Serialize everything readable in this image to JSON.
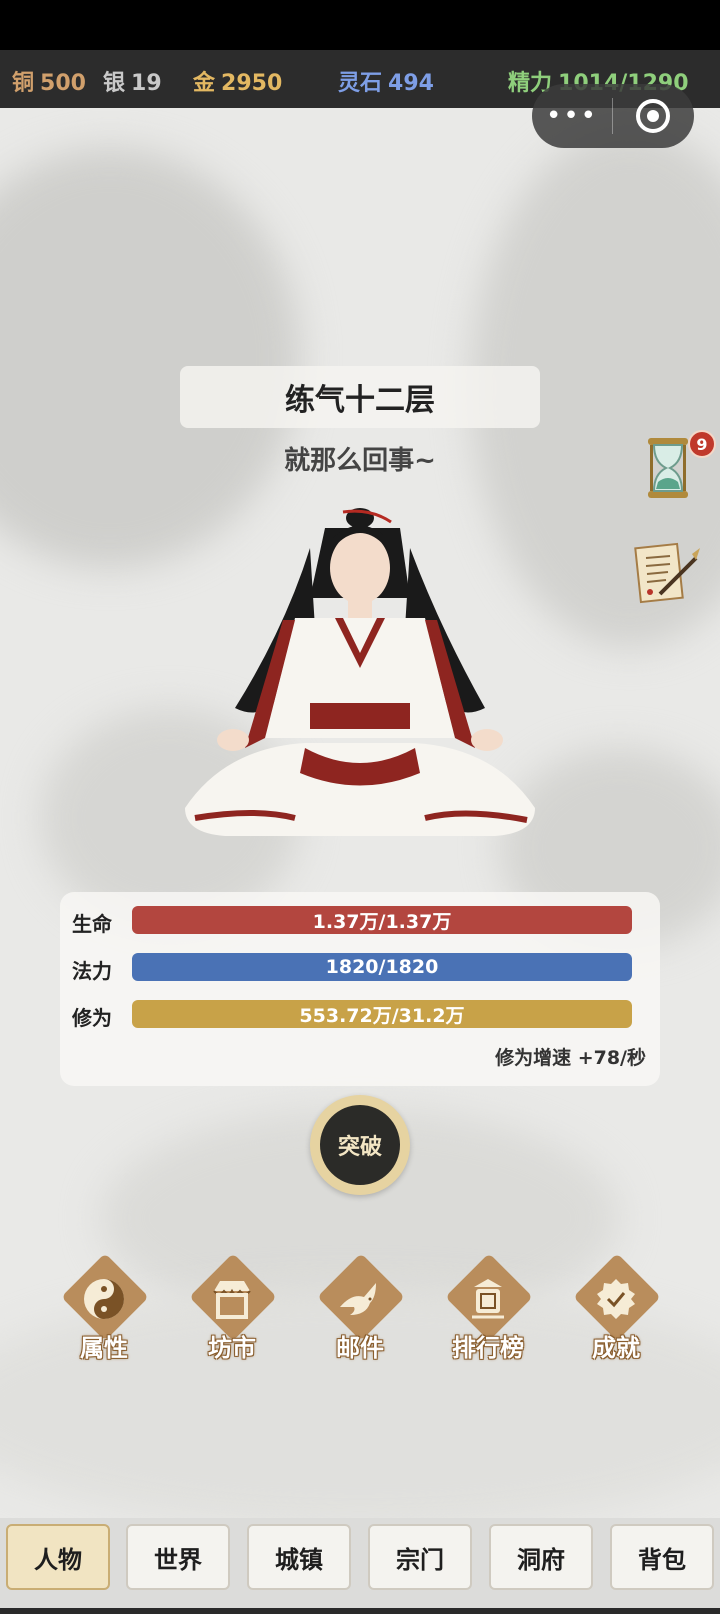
{
  "topbar": {
    "resources": [
      {
        "label": "铜",
        "value": "500",
        "color": "#d1a06c"
      },
      {
        "label": "银",
        "value": "19",
        "color": "#c9c9c9"
      },
      {
        "label": "金",
        "value": "2950",
        "color": "#e3b862"
      },
      {
        "label": "灵石",
        "value": "494",
        "color": "#7e9ee6"
      },
      {
        "label": "精力",
        "value": "1014/1290",
        "color": "#8fcf7c"
      }
    ]
  },
  "capsule": {
    "more_icon": "more-dots-icon",
    "close_icon": "target-icon"
  },
  "character": {
    "realm": "练气十二层",
    "motto": "就那么回事~"
  },
  "side_buttons": {
    "hourglass_badge": "9",
    "hourglass_icon": "hourglass-icon",
    "scroll_icon": "scroll-quill-icon"
  },
  "stats": {
    "hp": {
      "label": "生命",
      "value": "1.37万/1.37万",
      "fraction": 1.0,
      "color": "#b3463f"
    },
    "mp": {
      "label": "法力",
      "value": "1820/1820",
      "fraction": 1.0,
      "color": "#4a72b5"
    },
    "cultivation": {
      "label": "修为",
      "value": "553.72万/31.2万",
      "fraction": 1.0,
      "color": "#c8a248"
    },
    "speed": "修为增速 +78/秒"
  },
  "breakthrough": {
    "label": "突破"
  },
  "features": [
    {
      "label": "属性",
      "icon": "yin-yang-icon"
    },
    {
      "label": "坊市",
      "icon": "shop-icon"
    },
    {
      "label": "邮件",
      "icon": "dove-icon"
    },
    {
      "label": "排行榜",
      "icon": "ranking-banner-icon"
    },
    {
      "label": "成就",
      "icon": "achievement-badge-icon"
    }
  ],
  "tabs": [
    {
      "label": "人物",
      "active": true
    },
    {
      "label": "世界",
      "active": false
    },
    {
      "label": "城镇",
      "active": false
    },
    {
      "label": "宗门",
      "active": false
    },
    {
      "label": "洞府",
      "active": false
    },
    {
      "label": "背包",
      "active": false
    }
  ]
}
